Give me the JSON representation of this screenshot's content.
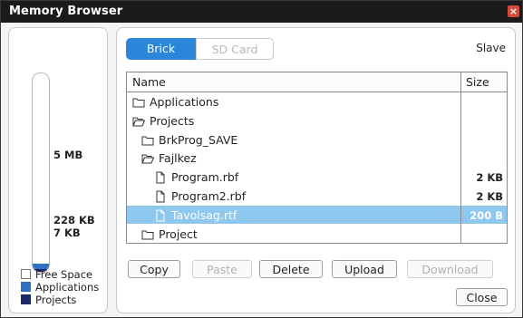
{
  "window": {
    "title": "Memory Browser",
    "close_glyph": "×"
  },
  "storage": {
    "marks": {
      "top": "5 MB",
      "middle": "228 KB",
      "bottom": "7 KB"
    },
    "fill": {
      "applications_fraction": 0.04,
      "projects_fraction": 0.012
    },
    "legend": [
      {
        "label": "Free Space",
        "color": "#ffffff"
      },
      {
        "label": "Applications",
        "color": "#2e72c6"
      },
      {
        "label": "Projects",
        "color": "#1d2a6a"
      }
    ]
  },
  "tabs": {
    "brick": "Brick",
    "sd_card": "SD Card"
  },
  "connection": "Slave",
  "table": {
    "headers": {
      "name": "Name",
      "size": "Size"
    },
    "rows": [
      {
        "name": "Applications",
        "size": "",
        "icon": "folder-icon",
        "level": 0,
        "selected": false
      },
      {
        "name": "Projects",
        "size": "",
        "icon": "folder-open-icon",
        "level": 0,
        "selected": false
      },
      {
        "name": "BrkProg_SAVE",
        "size": "",
        "icon": "folder-icon",
        "level": 1,
        "selected": false
      },
      {
        "name": "Fajlkez",
        "size": "",
        "icon": "folder-open-icon",
        "level": 1,
        "selected": false
      },
      {
        "name": "Program.rbf",
        "size": "2 KB",
        "icon": "file-icon",
        "level": 2,
        "selected": false
      },
      {
        "name": "Program2.rbf",
        "size": "2 KB",
        "icon": "file-icon",
        "level": 2,
        "selected": false
      },
      {
        "name": "Tavolsag.rtf",
        "size": "200 B",
        "icon": "file-icon",
        "level": 2,
        "selected": true
      },
      {
        "name": "Project",
        "size": "",
        "icon": "folder-icon",
        "level": 1,
        "selected": false
      }
    ]
  },
  "buttons": {
    "copy": "Copy",
    "paste": "Paste",
    "delete": "Delete",
    "upload": "Upload",
    "download": "Download",
    "close": "Close"
  }
}
